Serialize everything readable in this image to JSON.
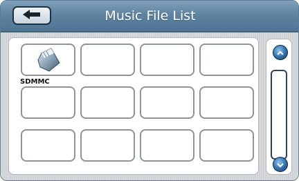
{
  "header": {
    "title": "Music File List",
    "back_icon": "left-arrow-icon"
  },
  "grid": {
    "cells": [
      {
        "label": "SDMMC",
        "icon": "sd-card-icon"
      },
      {
        "label": ""
      },
      {
        "label": ""
      },
      {
        "label": ""
      },
      {
        "label": ""
      },
      {
        "label": ""
      },
      {
        "label": ""
      },
      {
        "label": ""
      },
      {
        "label": ""
      },
      {
        "label": ""
      },
      {
        "label": ""
      },
      {
        "label": ""
      }
    ]
  },
  "scrollbar": {
    "up_icon": "chevron-up-icon",
    "down_icon": "chevron-down-icon"
  },
  "colors": {
    "title_bar": "#5f84a1",
    "scroll_button": "#2f6ea8",
    "cell_border": "#8d9396"
  }
}
